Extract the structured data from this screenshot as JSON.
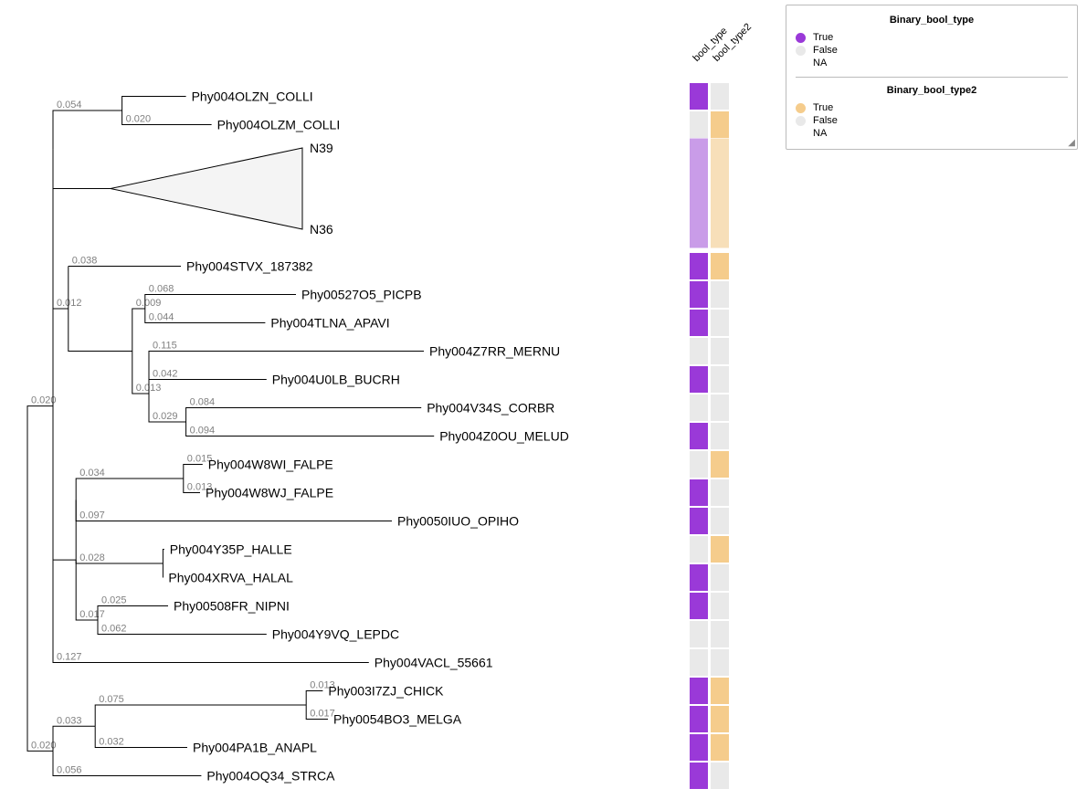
{
  "legend": {
    "section1_title": "Binary_bool_type",
    "section2_title": "Binary_bool_type2",
    "true_label": "True",
    "false_label": "False",
    "na_label": "NA",
    "colors": {
      "bool_type_true": "#9a39d8",
      "bool_type_true_faded": "#c99ce8",
      "false": "#e9e9e9",
      "bool_type2_true": "#f5cc8c",
      "bool_type2_true_faded": "#f7dfb9"
    }
  },
  "column_headers": {
    "col1": "bool_type",
    "col2": "bool_type2"
  },
  "chart_data": {
    "type": "phylogenetic-tree",
    "title": "",
    "column_annotations": [
      "bool_type",
      "bool_type2"
    ],
    "collapsed_clade": {
      "top_label": "N39",
      "bottom_label": "N36"
    },
    "nodes": [
      {
        "id": "root",
        "parent": null,
        "len": 0.02,
        "show_len": true
      },
      {
        "id": "n_upper",
        "parent": "root",
        "len": 0.02,
        "show_len": true
      },
      {
        "id": "n_top",
        "parent": "n_upper",
        "len": 0
      },
      {
        "id": "n_olz",
        "parent": "n_top",
        "len": 0.054,
        "show_len": true
      },
      {
        "id": "L_OLZN",
        "parent": "n_olz",
        "len": 0.05,
        "label": "Phy004OLZN_COLLI",
        "bool_type": "true",
        "bool_type2": "false"
      },
      {
        "id": "L_OLZM",
        "parent": "n_olz",
        "len": 0.07,
        "len_label": "0.020",
        "label": "Phy004OLZM_COLLI",
        "bool_type": "false",
        "bool_type2": "true"
      },
      {
        "id": "n_collapsed",
        "parent": "n_top",
        "len": 0.045,
        "collapsed": true,
        "top_label": "N39",
        "bottom_label": "N36",
        "bool_type": "true_faded",
        "bool_type2": "true_faded"
      },
      {
        "id": "n_mid",
        "parent": "n_upper",
        "len": 0.012,
        "show_len": true
      },
      {
        "id": "n_stvx",
        "parent": "n_mid",
        "len": 0
      },
      {
        "id": "L_STVX",
        "parent": "n_stvx",
        "len": 0.088,
        "len_label": "0.038",
        "label": "Phy004STVX_187382",
        "bool_type": "true",
        "bool_type2": "true"
      },
      {
        "id": "n_pic_apa_wrap",
        "parent": "n_mid",
        "len": 0.05
      },
      {
        "id": "n_pic_apa",
        "parent": "n_pic_apa_wrap",
        "len": 0.01,
        "len_label": "0.009",
        "show_len": true
      },
      {
        "id": "L_PICPB",
        "parent": "n_pic_apa",
        "len": 0.118,
        "len_label": "0.068",
        "label": "Phy00527O5_PICPB",
        "bool_type": "true",
        "bool_type2": "false"
      },
      {
        "id": "L_APAVI",
        "parent": "n_pic_apa",
        "len": 0.094,
        "len_label": "0.044",
        "label": "Phy004TLNA_APAVI",
        "bool_type": "true",
        "bool_type2": "false"
      },
      {
        "id": "n_merbuc_wrap",
        "parent": "n_pic_apa_wrap",
        "len": 0.013,
        "show_len": true
      },
      {
        "id": "n_merbuc",
        "parent": "n_merbuc_wrap",
        "len": 0
      },
      {
        "id": "L_MERNU",
        "parent": "n_merbuc",
        "len": 0.215,
        "len_label": "0.115",
        "label": "Phy004Z7RR_MERNU",
        "bool_type": "false",
        "bool_type2": "false"
      },
      {
        "id": "L_BUCRH",
        "parent": "n_merbuc",
        "len": 0.092,
        "len_label": "0.042",
        "label": "Phy004U0LB_BUCRH",
        "bool_type": "true",
        "bool_type2": "false"
      },
      {
        "id": "n_corbr",
        "parent": "n_merbuc_wrap",
        "len": 0.029,
        "show_len": true
      },
      {
        "id": "L_CORBR",
        "parent": "n_corbr",
        "len": 0.184,
        "len_label": "0.084",
        "label": "Phy004V34S_CORBR",
        "bool_type": "false",
        "bool_type2": "false"
      },
      {
        "id": "L_MELUD",
        "parent": "n_corbr",
        "len": 0.194,
        "len_label": "0.094",
        "label": "Phy004Z0OU_MELUD",
        "bool_type": "true",
        "bool_type2": "false"
      },
      {
        "id": "n_low",
        "parent": "n_upper",
        "len": 0.018
      },
      {
        "id": "n_fal_opi",
        "parent": "n_low",
        "len": 0
      },
      {
        "id": "n_falpe",
        "parent": "n_fal_opi",
        "len": 0.084,
        "len_label": "0.034",
        "show_len": true
      },
      {
        "id": "L_FALPE1",
        "parent": "n_falpe",
        "len": 0.015,
        "len_label": "0.015",
        "label": "Phy004W8WI_FALPE",
        "bool_type": "false",
        "bool_type2": "true"
      },
      {
        "id": "L_FALPE2",
        "parent": "n_falpe",
        "len": 0.013,
        "len_label": "0.013",
        "label": "Phy004W8WJ_FALPE",
        "bool_type": "true",
        "bool_type2": "false"
      },
      {
        "id": "L_OPIHO",
        "parent": "n_fal_opi",
        "len": 0.247,
        "len_label": "0.097",
        "label": "Phy0050IUO_OPIHO",
        "bool_type": "true",
        "bool_type2": "false"
      },
      {
        "id": "n_hall",
        "parent": "n_low",
        "len": 0.068,
        "len_label": "0.028",
        "show_len": true
      },
      {
        "id": "L_HALLE",
        "parent": "n_hall",
        "len": 0.001,
        "label": "Phy004Y35P_HALLE",
        "bool_type": "false",
        "bool_type2": "true"
      },
      {
        "id": "L_HALAL",
        "parent": "n_hall",
        "len": 0,
        "label": "Phy004XRVA_HALAL",
        "bool_type": "true",
        "bool_type2": "false"
      },
      {
        "id": "n_nip",
        "parent": "n_low",
        "len": 0.017,
        "show_len": true
      },
      {
        "id": "L_NIPNI",
        "parent": "n_nip",
        "len": 0.055,
        "len_label": "0.025",
        "label": "Phy00508FR_NIPNI",
        "bool_type": "true",
        "bool_type2": "false"
      },
      {
        "id": "L_LEPDC",
        "parent": "n_nip",
        "len": 0.132,
        "len_label": "0.062",
        "label": "Phy004Y9VQ_LEPDC",
        "bool_type": "false",
        "bool_type2": "false"
      },
      {
        "id": "L_VACL",
        "parent": "n_upper",
        "len": 0.247,
        "len_label": "0.127",
        "label": "Phy004VACL_55661",
        "bool_type": "false",
        "bool_type2": "false"
      },
      {
        "id": "n_bot",
        "parent": "root",
        "len": 0.02,
        "show_len": true
      },
      {
        "id": "n_gall",
        "parent": "n_bot",
        "len": 0.033,
        "show_len": true
      },
      {
        "id": "n_chickmel",
        "parent": "n_gall",
        "len": 0.165,
        "len_label": "0.075",
        "show_len": true
      },
      {
        "id": "L_CHICK",
        "parent": "n_chickmel",
        "len": 0.013,
        "len_label": "0.013",
        "label": "Phy003I7ZJ_CHICK",
        "bool_type": "true",
        "bool_type2": "true"
      },
      {
        "id": "L_MELGA",
        "parent": "n_chickmel",
        "len": 0.017,
        "len_label": "0.017",
        "label": "Phy0054BO3_MELGA",
        "bool_type": "true",
        "bool_type2": "true"
      },
      {
        "id": "L_ANAPL",
        "parent": "n_gall",
        "len": 0.072,
        "len_label": "0.032",
        "label": "Phy004PA1B_ANAPL",
        "bool_type": "true",
        "bool_type2": "true"
      },
      {
        "id": "L_STRCA",
        "parent": "n_bot",
        "len": 0.116,
        "len_label": "0.056",
        "label": "Phy004OQ34_STRCA",
        "bool_type": "true",
        "bool_type2": "false"
      }
    ]
  }
}
